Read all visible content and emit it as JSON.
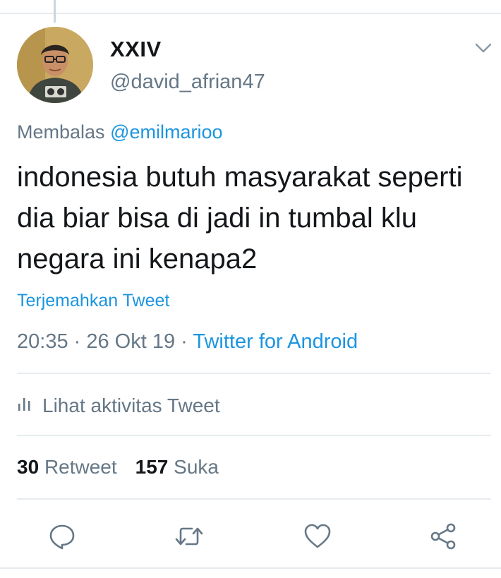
{
  "tweet": {
    "display_name": "XXIV",
    "handle": "@david_afrian47",
    "reply_prefix": "Membalas",
    "reply_mention": "@emilmarioo",
    "text": "indonesia butuh masyarakat seperti dia biar bisa di jadi in tumbal klu negara ini kenapa2",
    "translate_label": "Terjemahkan Tweet",
    "time": "20:35",
    "date": "26 Okt 19",
    "separator": " · ",
    "source": "Twitter for Android",
    "activity_label": "Lihat aktivitas Tweet",
    "retweet_count": "30",
    "retweet_label": "Retweet",
    "like_count": "157",
    "like_label": "Suka"
  },
  "icons": {
    "menu": "chevron-down-icon",
    "activity": "bar-chart-icon",
    "reply": "reply-icon",
    "retweet": "retweet-icon",
    "like": "heart-icon",
    "share": "share-icon"
  },
  "colors": {
    "link": "#1b95e0",
    "secondary_text": "#657786",
    "primary_text": "#14171a",
    "divider": "#e6ecf0"
  }
}
